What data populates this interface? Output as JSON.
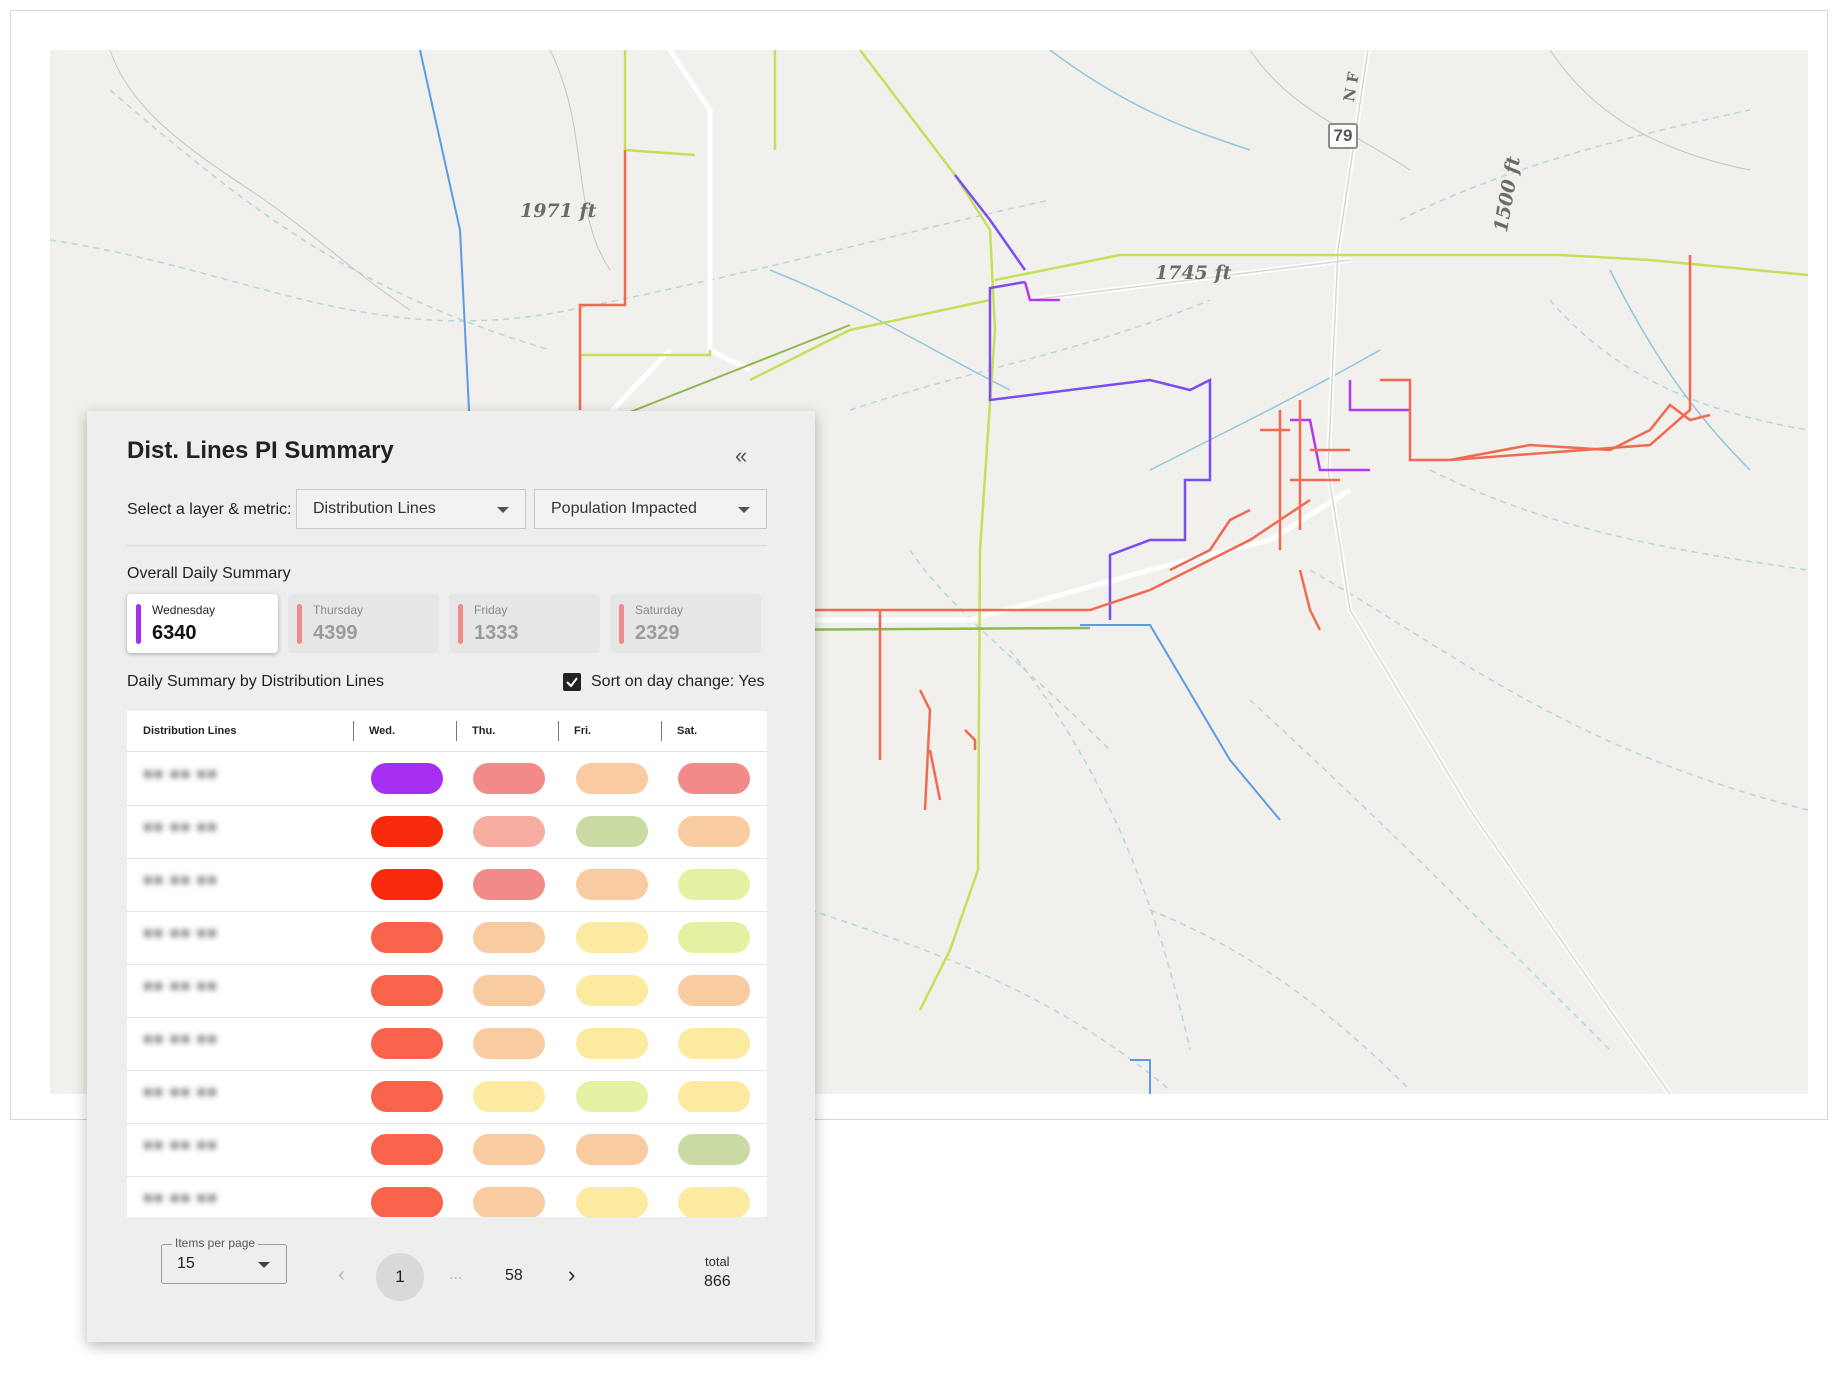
{
  "map": {
    "elevation_labels": [
      "1971 ft",
      "1745 ft",
      "1500 ft"
    ],
    "route_shield": "79",
    "road_label": "N F"
  },
  "panel": {
    "title": "Dist. Lines PI Summary",
    "collapse_icon": "double-chevron-left-icon",
    "select_label": "Select a layer & metric:",
    "layer_value": "Distribution Lines",
    "metric_value": "Population Impacted",
    "overall_label": "Overall Daily Summary",
    "days": [
      {
        "name": "Wednesday",
        "value": "6340",
        "color": "#a52ef0",
        "active": true
      },
      {
        "name": "Thursday",
        "value": "4399",
        "color": "#f28a8a",
        "active": false
      },
      {
        "name": "Friday",
        "value": "1333",
        "color": "#f28a8a",
        "active": false
      },
      {
        "name": "Saturday",
        "value": "2329",
        "color": "#f28a8a",
        "active": false
      }
    ],
    "by_lines_label": "Daily Summary by Distribution Lines",
    "sort_label": "Sort on day change: Yes",
    "sort_checked": true,
    "table": {
      "headers": [
        "Distribution Lines",
        "Wed.",
        "Thu.",
        "Fri.",
        "Sat."
      ],
      "rows": [
        {
          "name": "■■ ■■ ■■",
          "colors": [
            "#a52ef0",
            "#f28a8a",
            "#f9cba1",
            "#f28a8a"
          ]
        },
        {
          "name": "■■ ■■ ■■",
          "colors": [
            "#f72b0b",
            "#f8ada3",
            "#c9dba3",
            "#f9cba1"
          ]
        },
        {
          "name": "■■ ■■ ■■",
          "colors": [
            "#f72b0b",
            "#f28a8a",
            "#f9cba1",
            "#e6f0a3"
          ]
        },
        {
          "name": "■■ ■■ ■■",
          "colors": [
            "#f7634b",
            "#f9cba1",
            "#fbeaa0",
            "#e6f0a3"
          ]
        },
        {
          "name": "■■ ■■ ■■",
          "colors": [
            "#f7634b",
            "#f9cba1",
            "#fbeaa0",
            "#f9cba1"
          ]
        },
        {
          "name": "■■ ■■ ■■",
          "colors": [
            "#f7634b",
            "#f9cba1",
            "#fbeaa0",
            "#fbeaa0"
          ]
        },
        {
          "name": "■■ ■■ ■■",
          "colors": [
            "#f7634b",
            "#fbeaa0",
            "#e6f0a3",
            "#fbeaa0"
          ]
        },
        {
          "name": "■■ ■■ ■■",
          "colors": [
            "#f7634b",
            "#f9cba1",
            "#f9cba1",
            "#c9dba3"
          ]
        },
        {
          "name": "■■ ■■ ■■",
          "colors": [
            "#f7634b",
            "#f9cba1",
            "#fbeaa0",
            "#fbeaa0"
          ]
        }
      ]
    },
    "pagination": {
      "items_per_page_label": "Items per page",
      "items_per_page_value": "15",
      "prev_icon": "chevron-left-icon",
      "current_page": "1",
      "ellipsis": "...",
      "last_page": "58",
      "next_icon": "chevron-right-icon",
      "total_label": "total",
      "total_value": "866"
    }
  }
}
